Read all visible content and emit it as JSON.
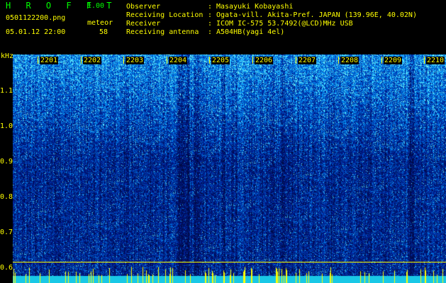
{
  "app": {
    "name": "H R O F F T",
    "version": "1.00"
  },
  "file": {
    "name": "0501122200.png",
    "datetime": "05.01.12 22:00"
  },
  "detection": {
    "label": "meteor",
    "count": "58"
  },
  "info": [
    {
      "label": "Observer",
      "value": "Masayuki Kobayashi"
    },
    {
      "label": "Receiving Location",
      "value": "Ogata-vill. Akita-Pref. JAPAN (139.96E, 40.02N)"
    },
    {
      "label": "Receiver",
      "value": "ICOM IC-575 53.7492(@LCD)MHz USB"
    },
    {
      "label": "Receiving antenna",
      "value": "A504HB(yagi 4el)"
    }
  ],
  "colon": ":",
  "colors": {
    "header_text": "#ffff00",
    "app_name": "#00ff00",
    "background": "#000000",
    "spectrum_base": "#0a3aa8"
  },
  "chart_data": {
    "type": "heatmap",
    "y_unit": "kHz",
    "y_ticks": [
      "1.1",
      "1.0",
      "0.9",
      "0.8",
      "0.7",
      "0.6"
    ],
    "y_range": [
      0.6,
      1.15
    ],
    "time_labels": [
      "2201",
      "2202",
      "2203",
      "2204",
      "2205",
      "2206",
      "2207",
      "2208",
      "2209",
      "2210"
    ],
    "reference_line_khz": 0.617
  }
}
